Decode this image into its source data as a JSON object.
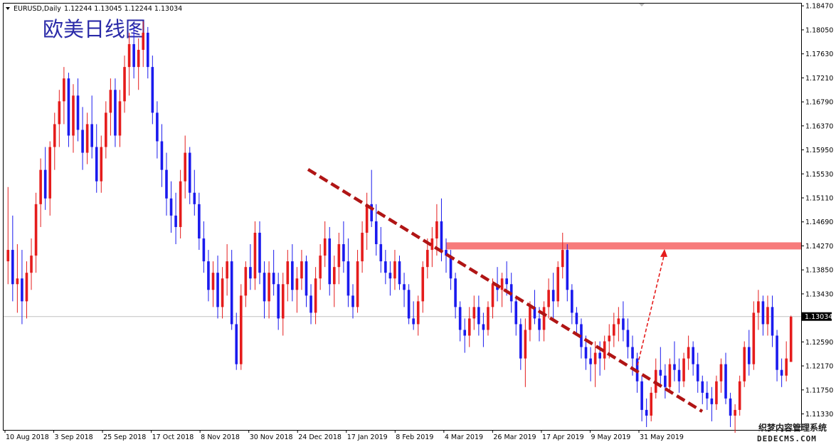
{
  "header": {
    "symbol_text": "EURUSD,Daily",
    "ohlc_text": "1.12244 1.13045 1.12244 1.13034"
  },
  "overlay_title": "欧美日线图",
  "watermark": {
    "line1": "织梦内容管理系统",
    "line2": "DEDECMS.COM"
  },
  "colors": {
    "up": "#e51c1c",
    "down": "#1a1aee",
    "trendline": "#b01515",
    "resistance_band": "#f77b7b",
    "price_box": "#000000",
    "title": "#2a2aa8"
  },
  "chart_data": {
    "type": "candlestick",
    "symbol": "EURUSD",
    "timeframe": "Daily",
    "y_ticks": [
      "1.18470",
      "1.18050",
      "1.17630",
      "1.17210",
      "1.16790",
      "1.16370",
      "1.15950",
      "1.15530",
      "1.15110",
      "1.14690",
      "1.14270",
      "1.13850",
      "1.13430",
      "1.13034",
      "1.12590",
      "1.12170",
      "1.11750",
      "1.11330"
    ],
    "ylim": [
      1.1105,
      1.1851
    ],
    "x_ticks": [
      "10 Aug 2018",
      "3 Sep 2018",
      "25 Sep 2018",
      "17 Oct 2018",
      "8 Nov 2018",
      "30 Nov 2018",
      "24 Dec 2018",
      "17 Jan 2019",
      "8 Feb 2019",
      "4 Mar 2019",
      "26 Mar 2019",
      "17 Apr 2019",
      "9 May 2019",
      "31 May 2019"
    ],
    "current_price": "1.13034",
    "resistance_level": 1.1427,
    "trendline": {
      "from": [
        2018.98,
        1.1555
      ],
      "to": [
        2019.475,
        1.1128
      ]
    },
    "projection": {
      "from": 1.1218,
      "to": 1.1419
    },
    "candles": [
      [
        1.14,
        1.153,
        1.136,
        1.142
      ],
      [
        1.142,
        1.148,
        1.133,
        1.136
      ],
      [
        1.136,
        1.143,
        1.131,
        1.137
      ],
      [
        1.137,
        1.142,
        1.129,
        1.133
      ],
      [
        1.133,
        1.14,
        1.13,
        1.138
      ],
      [
        1.138,
        1.144,
        1.135,
        1.141
      ],
      [
        1.141,
        1.152,
        1.138,
        1.15
      ],
      [
        1.15,
        1.158,
        1.146,
        1.156
      ],
      [
        1.156,
        1.16,
        1.149,
        1.151
      ],
      [
        1.151,
        1.161,
        1.148,
        1.16
      ],
      [
        1.16,
        1.166,
        1.156,
        1.164
      ],
      [
        1.164,
        1.17,
        1.16,
        1.168
      ],
      [
        1.168,
        1.174,
        1.164,
        1.172
      ],
      [
        1.172,
        1.173,
        1.16,
        1.162
      ],
      [
        1.162,
        1.171,
        1.159,
        1.169
      ],
      [
        1.169,
        1.172,
        1.161,
        1.163
      ],
      [
        1.163,
        1.167,
        1.156,
        1.159
      ],
      [
        1.159,
        1.166,
        1.157,
        1.164
      ],
      [
        1.164,
        1.169,
        1.158,
        1.16
      ],
      [
        1.16,
        1.164,
        1.152,
        1.154
      ],
      [
        1.154,
        1.162,
        1.152,
        1.16
      ],
      [
        1.16,
        1.168,
        1.158,
        1.166
      ],
      [
        1.166,
        1.172,
        1.162,
        1.17
      ],
      [
        1.17,
        1.172,
        1.16,
        1.162
      ],
      [
        1.162,
        1.17,
        1.16,
        1.168
      ],
      [
        1.168,
        1.176,
        1.166,
        1.174
      ],
      [
        1.174,
        1.18,
        1.169,
        1.178
      ],
      [
        1.178,
        1.181,
        1.172,
        1.174
      ],
      [
        1.174,
        1.179,
        1.17,
        1.177
      ],
      [
        1.177,
        1.182,
        1.174,
        1.18
      ],
      [
        1.18,
        1.181,
        1.172,
        1.174
      ],
      [
        1.174,
        1.176,
        1.164,
        1.166
      ],
      [
        1.166,
        1.168,
        1.158,
        1.161
      ],
      [
        1.161,
        1.164,
        1.153,
        1.156
      ],
      [
        1.156,
        1.159,
        1.148,
        1.151
      ],
      [
        1.151,
        1.154,
        1.145,
        1.148
      ],
      [
        1.148,
        1.152,
        1.143,
        1.146
      ],
      [
        1.146,
        1.156,
        1.144,
        1.154
      ],
      [
        1.154,
        1.162,
        1.151,
        1.159
      ],
      [
        1.159,
        1.16,
        1.15,
        1.152
      ],
      [
        1.152,
        1.156,
        1.148,
        1.15
      ],
      [
        1.15,
        1.152,
        1.142,
        1.144
      ],
      [
        1.144,
        1.147,
        1.138,
        1.14
      ],
      [
        1.14,
        1.142,
        1.133,
        1.135
      ],
      [
        1.135,
        1.14,
        1.132,
        1.138
      ],
      [
        1.138,
        1.141,
        1.13,
        1.132
      ],
      [
        1.132,
        1.139,
        1.13,
        1.137
      ],
      [
        1.137,
        1.143,
        1.134,
        1.14
      ],
      [
        1.14,
        1.142,
        1.128,
        1.129
      ],
      [
        1.129,
        1.131,
        1.121,
        1.122
      ],
      [
        1.122,
        1.136,
        1.121,
        1.134
      ],
      [
        1.134,
        1.14,
        1.132,
        1.139
      ],
      [
        1.139,
        1.143,
        1.135,
        1.137
      ],
      [
        1.137,
        1.147,
        1.135,
        1.145
      ],
      [
        1.145,
        1.147,
        1.136,
        1.138
      ],
      [
        1.138,
        1.14,
        1.13,
        1.133
      ],
      [
        1.133,
        1.14,
        1.13,
        1.138
      ],
      [
        1.138,
        1.142,
        1.134,
        1.136
      ],
      [
        1.136,
        1.138,
        1.128,
        1.13
      ],
      [
        1.13,
        1.138,
        1.127,
        1.136
      ],
      [
        1.136,
        1.142,
        1.133,
        1.14
      ],
      [
        1.14,
        1.143,
        1.133,
        1.135
      ],
      [
        1.135,
        1.139,
        1.131,
        1.137
      ],
      [
        1.137,
        1.142,
        1.135,
        1.14
      ],
      [
        1.14,
        1.141,
        1.132,
        1.134
      ],
      [
        1.134,
        1.136,
        1.129,
        1.131
      ],
      [
        1.131,
        1.139,
        1.129,
        1.137
      ],
      [
        1.137,
        1.143,
        1.135,
        1.141
      ],
      [
        1.141,
        1.147,
        1.139,
        1.144
      ],
      [
        1.144,
        1.146,
        1.134,
        1.136
      ],
      [
        1.136,
        1.141,
        1.132,
        1.139
      ],
      [
        1.139,
        1.145,
        1.136,
        1.143
      ],
      [
        1.143,
        1.147,
        1.138,
        1.14
      ],
      [
        1.14,
        1.144,
        1.132,
        1.134
      ],
      [
        1.134,
        1.136,
        1.13,
        1.132
      ],
      [
        1.132,
        1.142,
        1.131,
        1.14
      ],
      [
        1.14,
        1.147,
        1.138,
        1.145
      ],
      [
        1.145,
        1.152,
        1.142,
        1.15
      ],
      [
        1.15,
        1.156,
        1.146,
        1.147
      ],
      [
        1.147,
        1.15,
        1.141,
        1.143
      ],
      [
        1.143,
        1.146,
        1.138,
        1.14
      ],
      [
        1.14,
        1.142,
        1.136,
        1.138
      ],
      [
        1.138,
        1.14,
        1.134,
        1.137
      ],
      [
        1.137,
        1.142,
        1.135,
        1.14
      ],
      [
        1.14,
        1.141,
        1.135,
        1.136
      ],
      [
        1.136,
        1.138,
        1.132,
        1.135
      ],
      [
        1.135,
        1.136,
        1.129,
        1.13
      ],
      [
        1.13,
        1.133,
        1.128,
        1.129
      ],
      [
        1.129,
        1.134,
        1.127,
        1.133
      ],
      [
        1.133,
        1.14,
        1.131,
        1.139
      ],
      [
        1.139,
        1.144,
        1.137,
        1.142
      ],
      [
        1.142,
        1.146,
        1.139,
        1.144
      ],
      [
        1.144,
        1.15,
        1.141,
        1.147
      ],
      [
        1.147,
        1.151,
        1.14,
        1.142
      ],
      [
        1.142,
        1.144,
        1.138,
        1.141
      ],
      [
        1.141,
        1.142,
        1.135,
        1.137
      ],
      [
        1.137,
        1.138,
        1.13,
        1.132
      ],
      [
        1.132,
        1.133,
        1.126,
        1.128
      ],
      [
        1.128,
        1.13,
        1.124,
        1.127
      ],
      [
        1.127,
        1.132,
        1.125,
        1.13
      ],
      [
        1.13,
        1.134,
        1.128,
        1.132
      ],
      [
        1.132,
        1.134,
        1.127,
        1.129
      ],
      [
        1.129,
        1.131,
        1.125,
        1.128
      ],
      [
        1.128,
        1.133,
        1.127,
        1.132
      ],
      [
        1.132,
        1.137,
        1.13,
        1.136
      ],
      [
        1.136,
        1.139,
        1.133,
        1.135
      ],
      [
        1.135,
        1.138,
        1.132,
        1.137
      ],
      [
        1.137,
        1.14,
        1.134,
        1.136
      ],
      [
        1.136,
        1.138,
        1.131,
        1.133
      ],
      [
        1.133,
        1.134,
        1.127,
        1.129
      ],
      [
        1.129,
        1.13,
        1.121,
        1.123
      ],
      [
        1.123,
        1.13,
        1.118,
        1.128
      ],
      [
        1.128,
        1.133,
        1.126,
        1.132
      ],
      [
        1.132,
        1.135,
        1.129,
        1.13
      ],
      [
        1.13,
        1.132,
        1.126,
        1.128
      ],
      [
        1.128,
        1.133,
        1.126,
        1.132
      ],
      [
        1.132,
        1.137,
        1.13,
        1.135
      ],
      [
        1.135,
        1.138,
        1.13,
        1.133
      ],
      [
        1.133,
        1.14,
        1.132,
        1.139
      ],
      [
        1.139,
        1.145,
        1.137,
        1.142
      ],
      [
        1.142,
        1.143,
        1.133,
        1.135
      ],
      [
        1.135,
        1.136,
        1.129,
        1.131
      ],
      [
        1.131,
        1.132,
        1.127,
        1.129
      ],
      [
        1.129,
        1.13,
        1.123,
        1.125
      ],
      [
        1.125,
        1.127,
        1.121,
        1.123
      ],
      [
        1.123,
        1.125,
        1.119,
        1.122
      ],
      [
        1.122,
        1.126,
        1.118,
        1.124
      ],
      [
        1.124,
        1.126,
        1.12,
        1.123
      ],
      [
        1.123,
        1.127,
        1.121,
        1.126
      ],
      [
        1.126,
        1.129,
        1.123,
        1.127
      ],
      [
        1.127,
        1.131,
        1.125,
        1.129
      ],
      [
        1.129,
        1.132,
        1.126,
        1.13
      ],
      [
        1.13,
        1.133,
        1.126,
        1.128
      ],
      [
        1.128,
        1.13,
        1.123,
        1.125
      ],
      [
        1.125,
        1.127,
        1.12,
        1.123
      ],
      [
        1.123,
        1.124,
        1.117,
        1.119
      ],
      [
        1.119,
        1.12,
        1.112,
        1.114
      ],
      [
        1.114,
        1.116,
        1.111,
        1.113
      ],
      [
        1.113,
        1.118,
        1.112,
        1.117
      ],
      [
        1.117,
        1.123,
        1.116,
        1.121
      ],
      [
        1.121,
        1.125,
        1.118,
        1.12
      ],
      [
        1.12,
        1.122,
        1.116,
        1.118
      ],
      [
        1.118,
        1.123,
        1.117,
        1.122
      ],
      [
        1.122,
        1.126,
        1.119,
        1.121
      ],
      [
        1.121,
        1.123,
        1.117,
        1.119
      ],
      [
        1.119,
        1.124,
        1.118,
        1.123
      ],
      [
        1.123,
        1.127,
        1.121,
        1.125
      ],
      [
        1.125,
        1.126,
        1.12,
        1.122
      ],
      [
        1.122,
        1.124,
        1.117,
        1.119
      ],
      [
        1.119,
        1.12,
        1.115,
        1.117
      ],
      [
        1.117,
        1.119,
        1.114,
        1.116
      ],
      [
        1.116,
        1.118,
        1.112,
        1.115
      ],
      [
        1.115,
        1.12,
        1.114,
        1.119
      ],
      [
        1.119,
        1.123,
        1.117,
        1.122
      ],
      [
        1.122,
        1.124,
        1.115,
        1.116
      ],
      [
        1.116,
        1.117,
        1.111,
        1.113
      ],
      [
        1.113,
        1.115,
        1.11,
        1.114
      ],
      [
        1.114,
        1.12,
        1.113,
        1.119
      ],
      [
        1.119,
        1.126,
        1.118,
        1.125
      ],
      [
        1.125,
        1.128,
        1.12,
        1.122
      ],
      [
        1.122,
        1.133,
        1.121,
        1.131
      ],
      [
        1.131,
        1.135,
        1.128,
        1.133
      ],
      [
        1.133,
        1.134,
        1.127,
        1.129
      ],
      [
        1.129,
        1.134,
        1.127,
        1.132
      ],
      [
        1.132,
        1.134,
        1.125,
        1.127
      ],
      [
        1.127,
        1.128,
        1.119,
        1.121
      ],
      [
        1.121,
        1.123,
        1.118,
        1.12
      ],
      [
        1.12,
        1.126,
        1.119,
        1.123
      ],
      [
        1.1224,
        1.1305,
        1.1224,
        1.1303
      ]
    ]
  }
}
